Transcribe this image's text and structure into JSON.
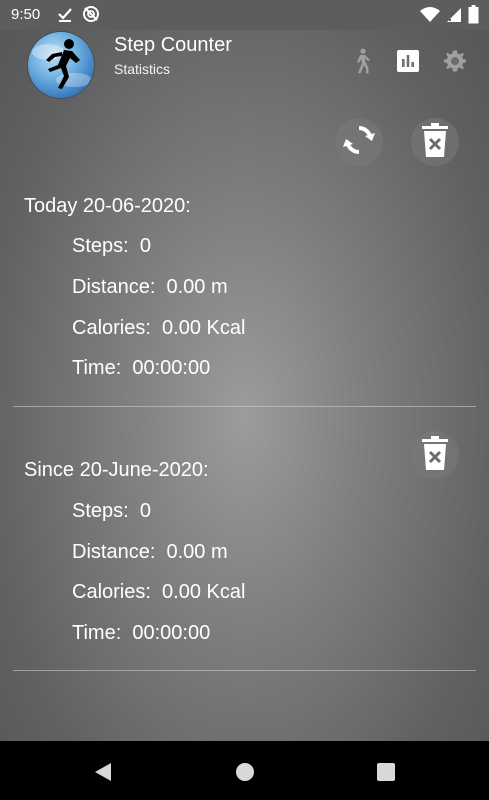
{
  "status_bar": {
    "time": "9:50",
    "icons": [
      "check-download-icon",
      "no-sync-icon",
      "wifi-icon",
      "signal-icon",
      "battery-icon"
    ]
  },
  "app_bar": {
    "title": "Step Counter",
    "subtitle": "Statistics",
    "logo_icon": "running-man-icon",
    "actions": [
      "walk-icon",
      "bar-chart-icon",
      "gear-icon"
    ]
  },
  "actions": {
    "refresh_icon": "refresh-icon",
    "delete_icon": "delete-icon"
  },
  "today": {
    "heading": "Today 20-06-2020:",
    "steps": "Steps:  0",
    "distance": "Distance:  0.00 m",
    "calories": "Calories:  0.00 Kcal",
    "time": "Time:  00:00:00"
  },
  "since": {
    "heading": "Since 20-June-2020:",
    "steps": "Steps:  0",
    "distance": "Distance:  0.00 m",
    "calories": "Calories:  0.00 Kcal",
    "time": "Time:  00:00:00"
  },
  "nav_bar": {
    "buttons": [
      "back-icon",
      "home-icon",
      "recents-icon"
    ]
  },
  "colors": {
    "status_bar": "#5b5d5f",
    "background_center": "#9a9c9e",
    "background_edge": "#535557",
    "text": "#ffffff",
    "nav_bar": "#000000"
  }
}
